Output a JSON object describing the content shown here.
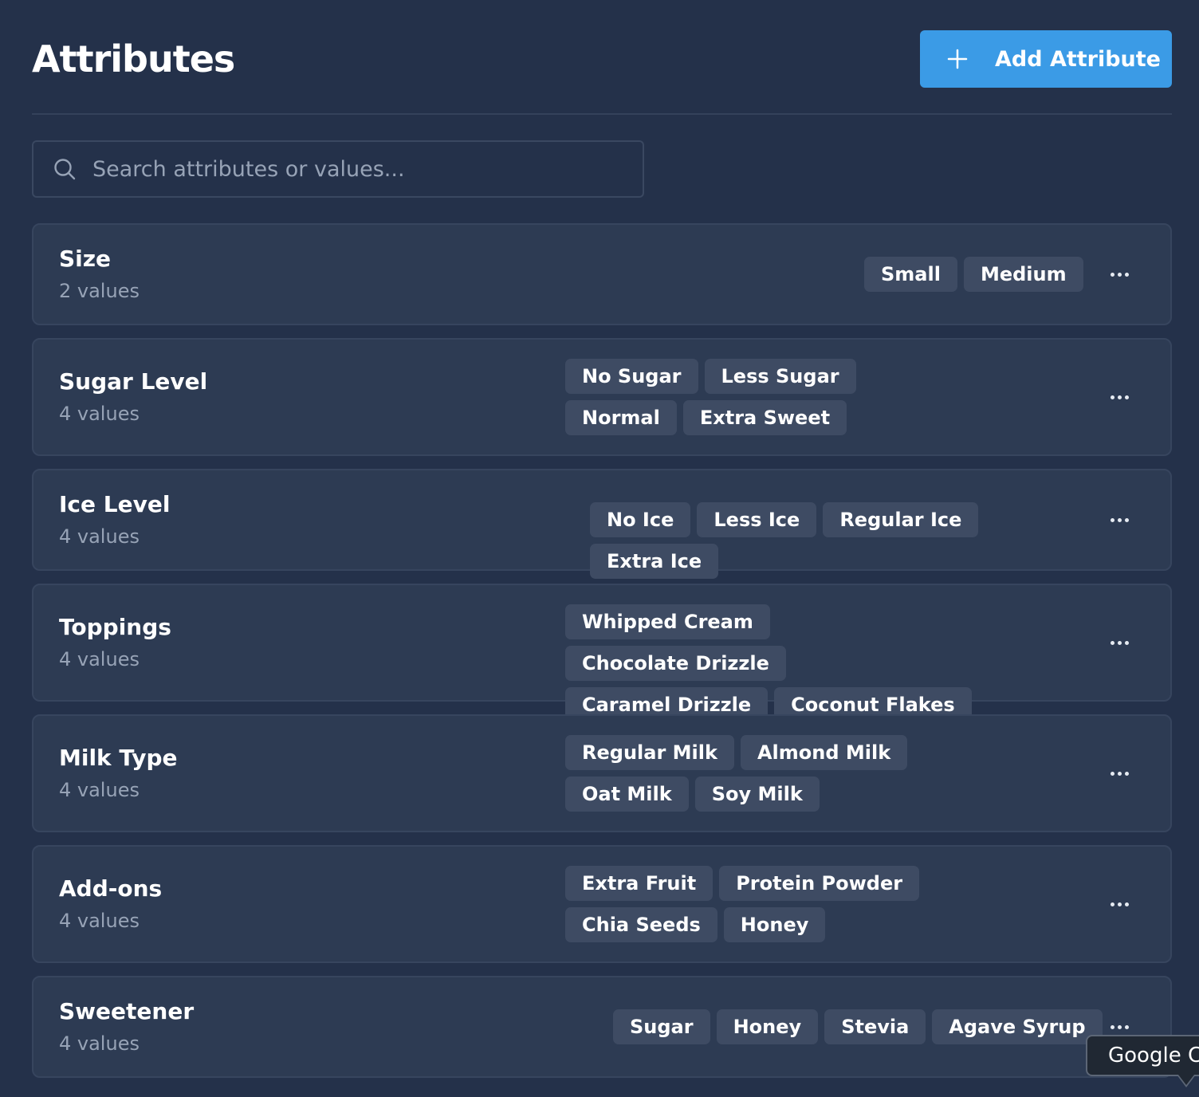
{
  "header": {
    "title": "Attributes",
    "add_button_label": "Add Attribute"
  },
  "search": {
    "placeholder": "Search attributes or values..."
  },
  "attributes": [
    {
      "name": "Size",
      "count_label": "2 values",
      "values": [
        "Small",
        "Medium"
      ]
    },
    {
      "name": "Sugar Level",
      "count_label": "4 values",
      "values": [
        "No Sugar",
        "Less Sugar",
        "Normal",
        "Extra Sweet"
      ]
    },
    {
      "name": "Ice Level",
      "count_label": "4 values",
      "values": [
        "No Ice",
        "Less Ice",
        "Regular Ice",
        "Extra Ice"
      ]
    },
    {
      "name": "Toppings",
      "count_label": "4 values",
      "values": [
        "Whipped Cream",
        "Chocolate Drizzle",
        "Caramel Drizzle",
        "Coconut Flakes"
      ]
    },
    {
      "name": "Milk Type",
      "count_label": "4 values",
      "values": [
        "Regular Milk",
        "Almond Milk",
        "Oat Milk",
        "Soy Milk"
      ]
    },
    {
      "name": "Add-ons",
      "count_label": "4 values",
      "values": [
        "Extra Fruit",
        "Protein Powder",
        "Chia Seeds",
        "Honey"
      ]
    },
    {
      "name": "Sweetener",
      "count_label": "4 values",
      "values": [
        "Sugar",
        "Honey",
        "Stevia",
        "Agave Syrup"
      ]
    }
  ],
  "tooltip": {
    "text": "Google C"
  },
  "colors": {
    "background": "#24314a",
    "card": "#2d3b53",
    "chip": "#3e4b63",
    "accent": "#3b9be6",
    "muted_text": "#97a3b6"
  },
  "icons": {
    "add": "plus-icon",
    "search": "search-icon",
    "more": "more-horizontal-icon"
  }
}
